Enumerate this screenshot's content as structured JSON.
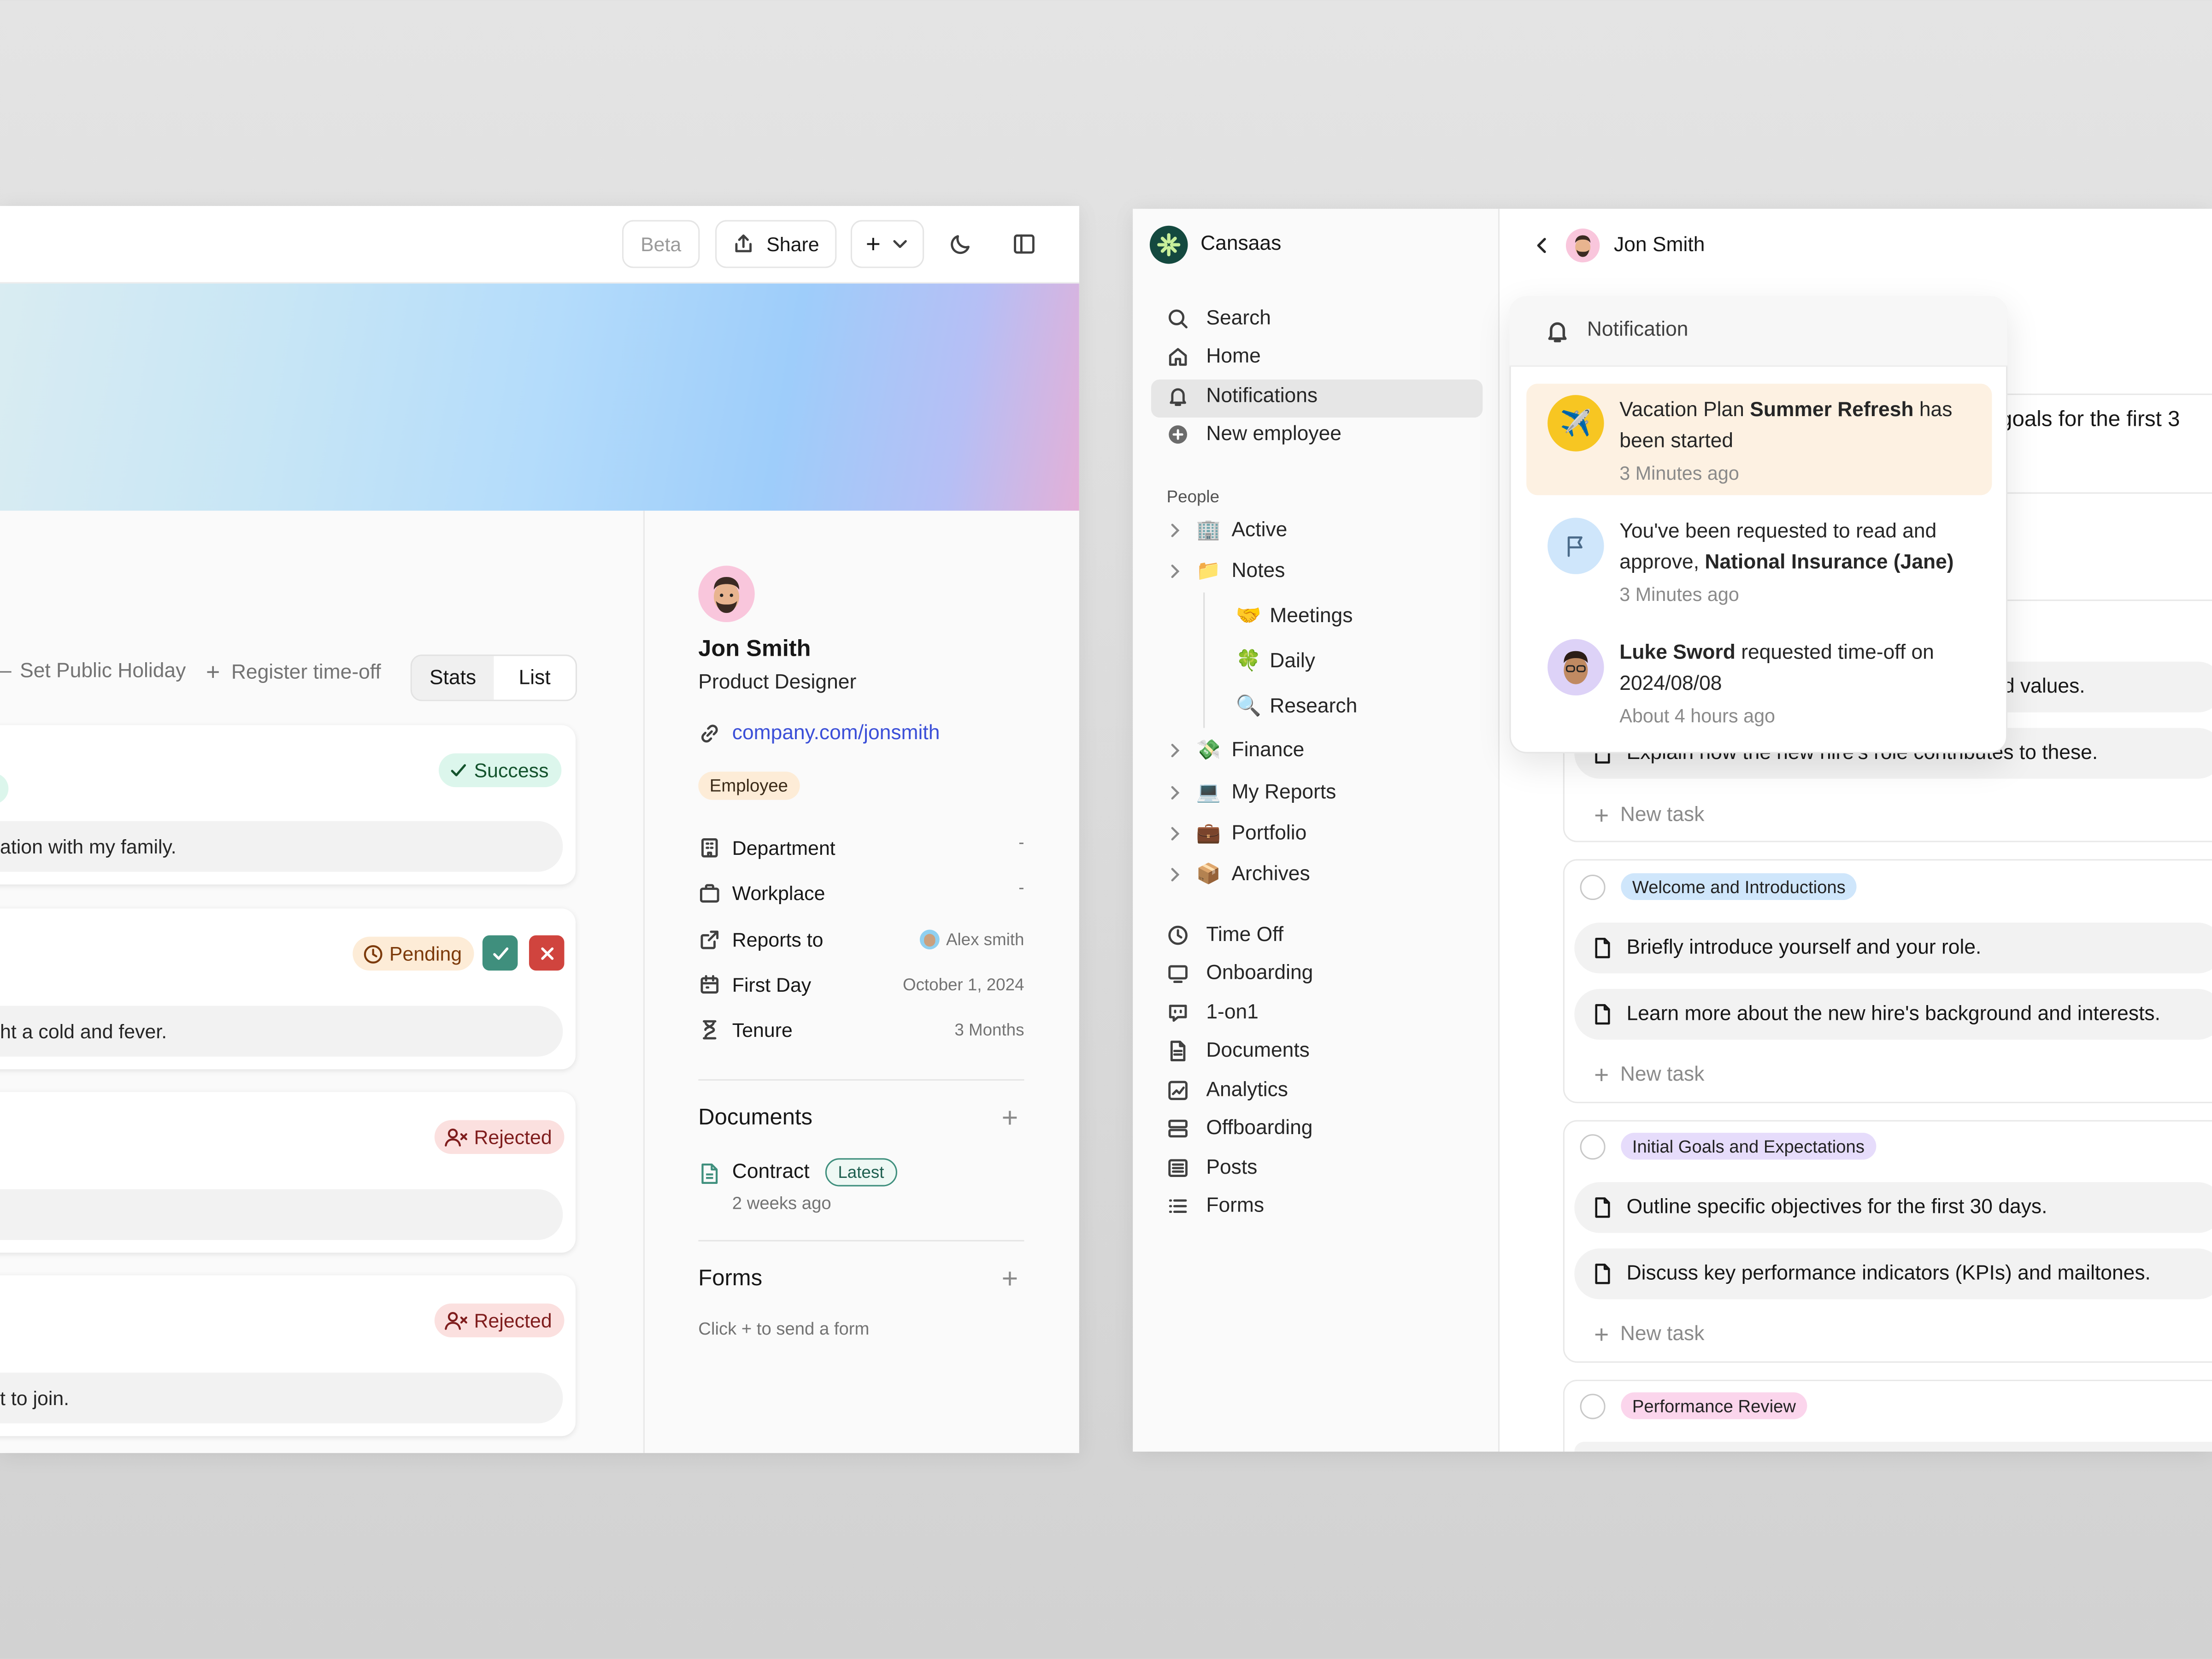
{
  "left": {
    "toolbar": {
      "beta": "Beta",
      "share": "Share",
      "add": "+"
    },
    "actions": {
      "holiday": "Set Public Holiday",
      "timeoff": "Register time-off",
      "stats": "Stats",
      "list": "List"
    },
    "cards": [
      {
        "status": "Success",
        "note": "ation with my family."
      },
      {
        "status": "Pending",
        "note": "ht a cold and fever."
      },
      {
        "status": "Rejected",
        "note": ""
      },
      {
        "status": "Rejected",
        "note": "t to join."
      }
    ],
    "profile": {
      "name": "Jon Smith",
      "role": "Product Designer",
      "link": "company.com/jonsmith",
      "badge": "Employee",
      "fields": [
        {
          "label": "Department",
          "value": "-"
        },
        {
          "label": "Workplace",
          "value": "-"
        },
        {
          "label": "Reports to",
          "value": "Alex smith"
        },
        {
          "label": "First Day",
          "value": "October 1, 2024"
        },
        {
          "label": "Tenure",
          "value": "3 Months"
        }
      ],
      "documents_title": "Documents",
      "doc_name": "Contract",
      "doc_badge": "Latest",
      "doc_time": "2 weeks ago",
      "forms_title": "Forms",
      "forms_hint": "Click + to send a form"
    }
  },
  "right": {
    "app_name": "Cansaas",
    "nav": [
      "Search",
      "Home",
      "Notifications",
      "New employee"
    ],
    "people_label": "People",
    "tree": [
      {
        "emoji": "🏢",
        "label": "Active"
      },
      {
        "emoji": "📁",
        "label": "Notes"
      }
    ],
    "notes_children": [
      {
        "emoji": "🤝",
        "label": "Meetings"
      },
      {
        "emoji": "🍀",
        "label": "Daily"
      },
      {
        "emoji": "🔍",
        "label": "Research"
      }
    ],
    "tree2": [
      {
        "emoji": "💸",
        "label": "Finance"
      },
      {
        "emoji": "💻",
        "label": "My Reports"
      },
      {
        "emoji": "💼",
        "label": "Portfolio"
      },
      {
        "emoji": "📦",
        "label": "Archives"
      }
    ],
    "nav2": [
      "Time Off",
      "Onboarding",
      "1-on1",
      "Documents",
      "Analytics",
      "Offboarding",
      "Posts",
      "Forms"
    ],
    "header_name": "Jon Smith",
    "notification": {
      "title": "Notification",
      "items": [
        {
          "pre": "Vacation Plan ",
          "bold": "Summer Refresh",
          "post": " has been started",
          "time": "3 Minutes ago"
        },
        {
          "pre": "You've been requested to read and approve, ",
          "bold": "National Insurance (Jane)",
          "post": "",
          "time": "3 Minutes ago"
        },
        {
          "pre": "",
          "bold": "Luke Sword",
          "post": " requested time-off on 2024/08/08",
          "time": "About 4 hours ago"
        }
      ]
    },
    "peek": {
      "goals": "l goals for the first 3",
      "values": "d values.",
      "explain": "Explain how the new hire's role contributes to these."
    },
    "groups": [
      {
        "tag": "Welcome and Introductions",
        "color": "#cfe6fb",
        "tasks": [
          "Briefly introduce yourself and your role.",
          "Learn more about the new hire's background and interests."
        ]
      },
      {
        "tag": "Initial Goals and Expectations",
        "color": "#e6dcfb",
        "tasks": [
          "Outline specific objectives for the first 30 days.",
          "Discuss key performance indicators (KPIs) and mailtones."
        ]
      },
      {
        "tag": "Performance Review",
        "color": "#fbd5ec",
        "tasks": []
      }
    ],
    "new_task": "New task"
  },
  "colors": {
    "accent": "#3b4fd8",
    "success_bg": "#dcf6ec",
    "pending_bg": "#fdecd7",
    "rejected_bg": "#fbe0df",
    "approve": "#3f8f7d",
    "reject": "#d0443e"
  }
}
